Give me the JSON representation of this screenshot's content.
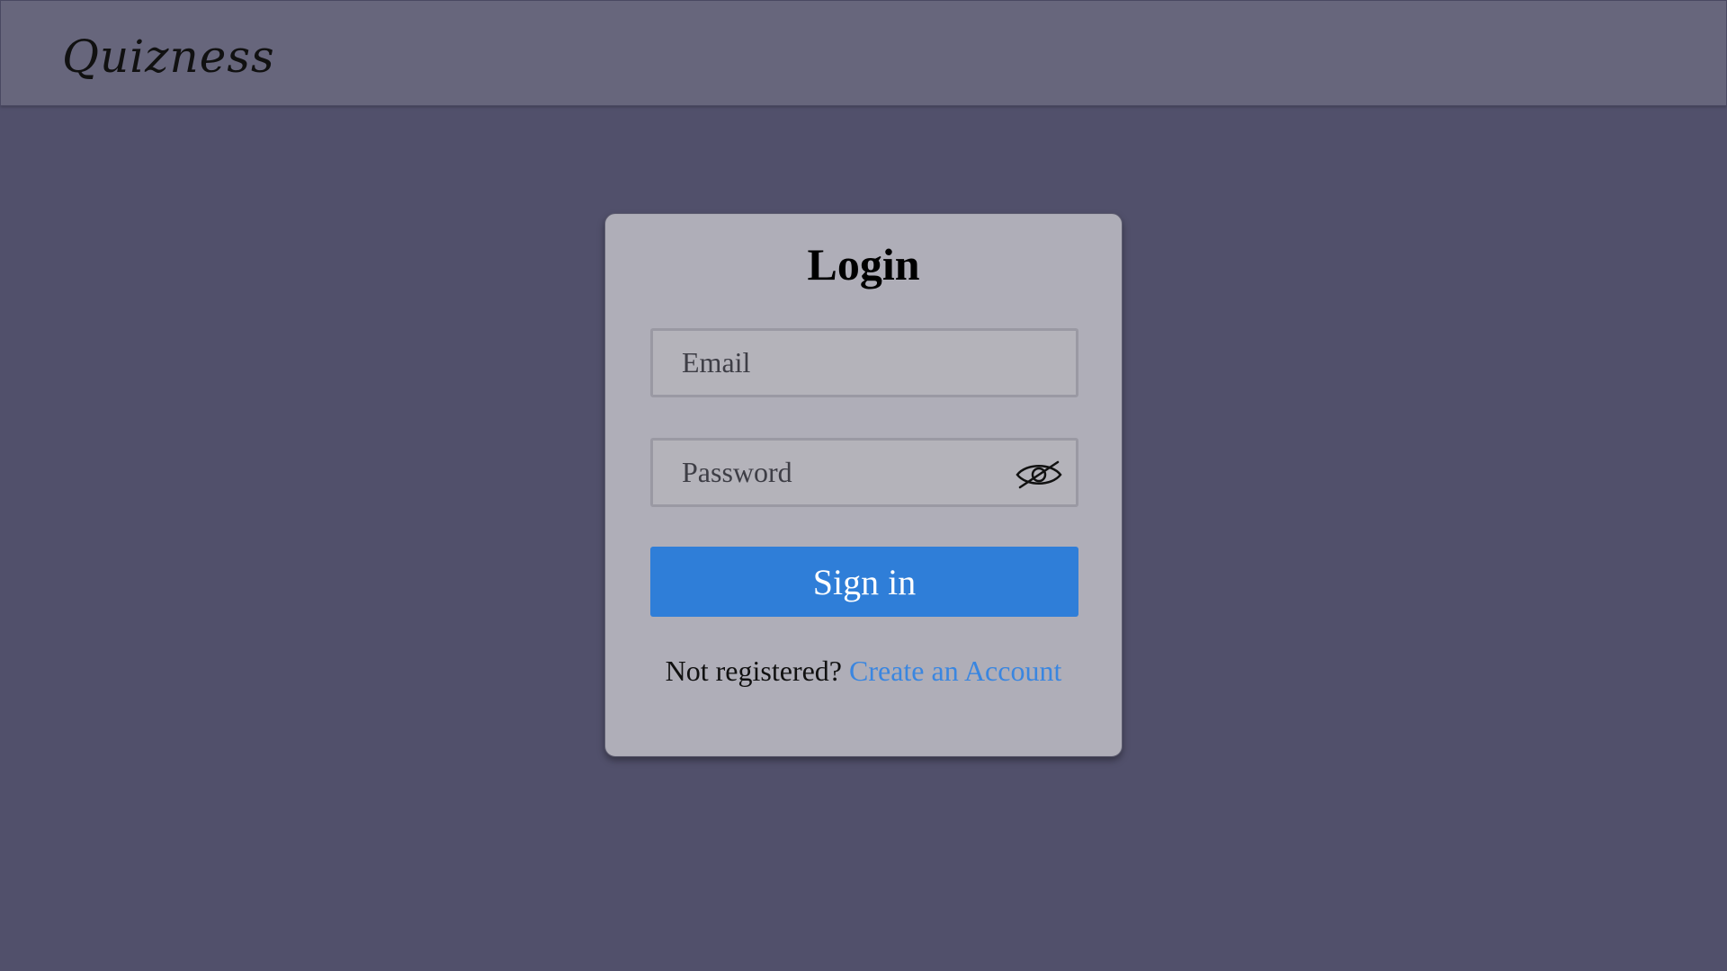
{
  "header": {
    "brand": "Quizness"
  },
  "login": {
    "title": "Login",
    "email_placeholder": "Email",
    "email_value": "",
    "password_placeholder": "Password",
    "password_value": "",
    "password_toggle_icon": "eye-slash-icon",
    "signin_label": "Sign in",
    "register_prompt": "Not registered?",
    "register_link": "Create an Account"
  },
  "colors": {
    "background": "#51506b",
    "navbar": "#67667c",
    "card": "#afaeb8",
    "primary_button": "#2f7ed8",
    "link": "#3a86e0"
  }
}
